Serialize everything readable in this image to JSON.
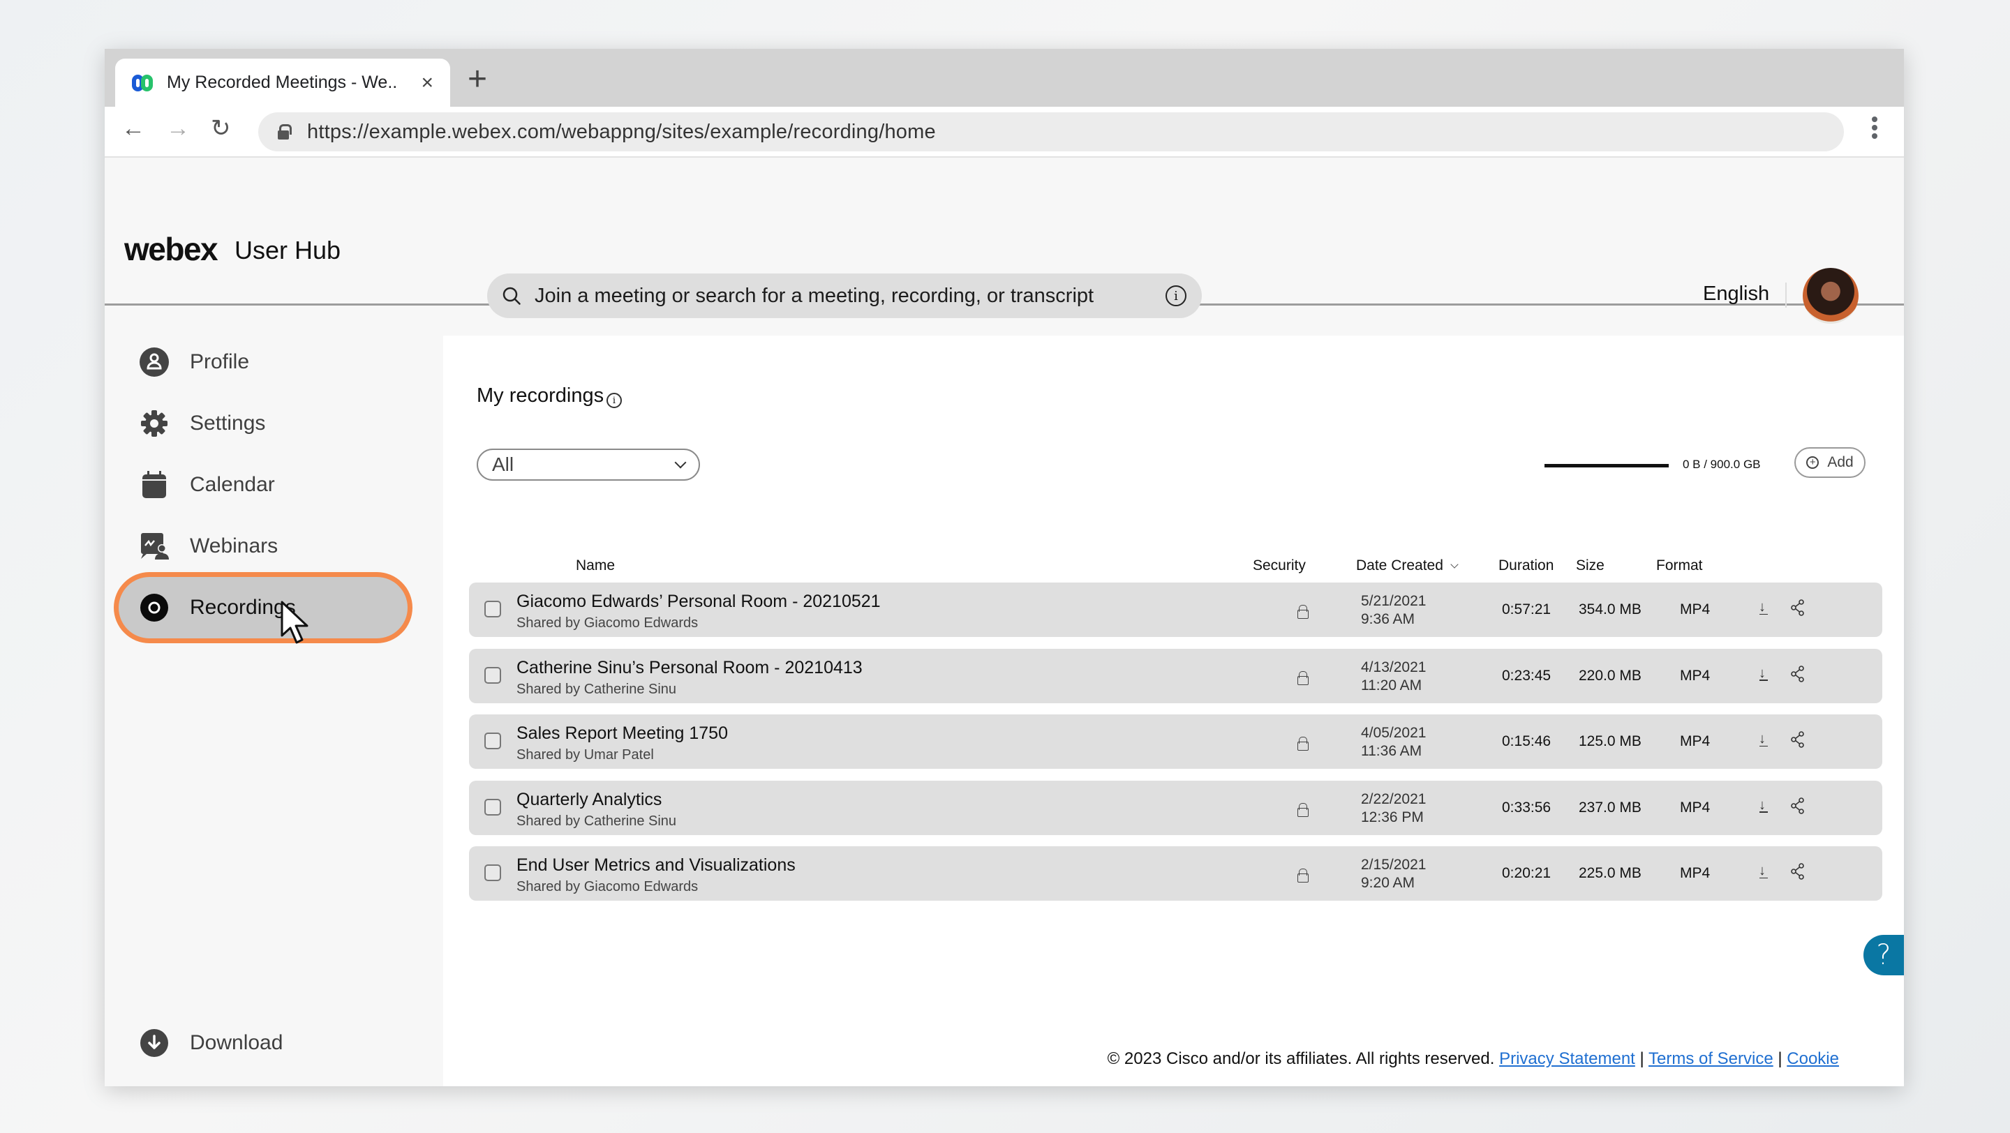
{
  "browser": {
    "tab_title": "My Recorded Meetings - We..",
    "tab_close": "×",
    "new_tab": "+",
    "url": "https://example.webex.com/webappng/sites/example/recording/home",
    "back": "←",
    "forward": "→",
    "reload": "↻"
  },
  "header": {
    "logo": "webex",
    "product": "User Hub"
  },
  "sidebar": {
    "items": [
      {
        "label": "Profile",
        "icon": "profile-icon"
      },
      {
        "label": "Settings",
        "icon": "gear-icon"
      },
      {
        "label": "Calendar",
        "icon": "calendar-icon"
      },
      {
        "label": "Webinars",
        "icon": "webinar-icon"
      },
      {
        "label": "Recordings",
        "icon": "recording-icon",
        "active": true
      }
    ],
    "bottom_items": [
      {
        "label": "Download",
        "icon": "download-icon"
      },
      {
        "label": "Help",
        "icon": "help-icon"
      }
    ]
  },
  "topbar": {
    "search_placeholder": "Join a meeting or search for a meeting, recording, or transcript",
    "info_glyph": "i",
    "language": "English"
  },
  "recordings": {
    "title": "My recordings",
    "filter_value": "All",
    "storage": {
      "used": "0 B",
      "total": "900.0 GB",
      "label": "0 B / 900.0 GB",
      "used_fraction": 0
    },
    "add_label": "Add",
    "columns": [
      "Name",
      "Security",
      "Date Created",
      "Duration",
      "Size",
      "Format"
    ],
    "sort_column": "Date Created",
    "rows": [
      {
        "name": "Giacomo Edwards’ Personal Room - 20210521",
        "shared": "Shared by Giacomo Edwards",
        "date": "5/21/2021",
        "time": "9:36 AM",
        "duration": "0:57:21",
        "size": "354.0 MB",
        "format": "MP4"
      },
      {
        "name": "Catherine Sinu’s Personal Room - 20210413",
        "shared": "Shared by Catherine Sinu",
        "date": "4/13/2021",
        "time": "11:20 AM",
        "duration": "0:23:45",
        "size": "220.0 MB",
        "format": "MP4"
      },
      {
        "name": "Sales Report Meeting 1750",
        "shared": "Shared by Umar Patel",
        "date": "4/05/2021",
        "time": "11:36 AM",
        "duration": "0:15:46",
        "size": "125.0 MB",
        "format": "MP4"
      },
      {
        "name": "Quarterly Analytics",
        "shared": "Shared by Catherine Sinu",
        "date": "2/22/2021",
        "time": "12:36 PM",
        "duration": "0:33:56",
        "size": "237.0 MB",
        "format": "MP4"
      },
      {
        "name": "End User Metrics and Visualizations",
        "shared": "Shared by Giacomo Edwards",
        "date": "2/15/2021",
        "time": "9:20 AM",
        "duration": "0:20:21",
        "size": "225.0 MB",
        "format": "MP4"
      }
    ]
  },
  "help_fab": "?",
  "footer": {
    "copyright": "© 2023 Cisco and/or its affiliates. All rights reserved.",
    "links": [
      "Privacy Statement",
      "Terms of Service",
      "Cookie"
    ],
    "separator": "|"
  },
  "colors": {
    "active_outline": "#f58a4b",
    "active_bg": "#c9c9c9",
    "link": "#1f6fd1",
    "help_fab": "#0a77a3"
  }
}
